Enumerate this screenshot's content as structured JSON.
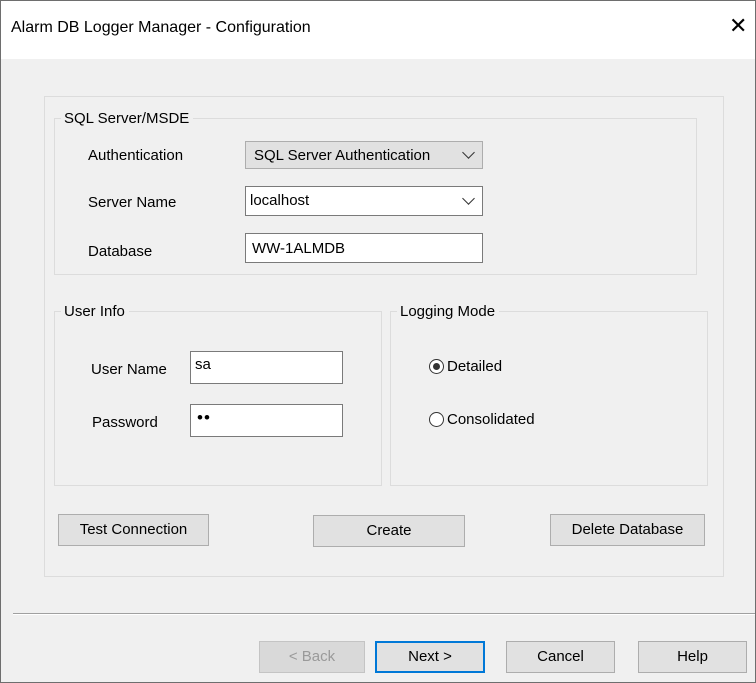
{
  "window": {
    "title": "Alarm DB Logger Manager - Configuration",
    "close_glyph": "✕"
  },
  "sql": {
    "legend": "SQL Server/MSDE",
    "auth_label": "Authentication",
    "auth_value": "SQL Server Authentication",
    "server_label": "Server Name",
    "server_value": "localhost",
    "db_label": "Database",
    "db_value": "WW-1ALMDB"
  },
  "user": {
    "legend": "User Info",
    "name_label": "User Name",
    "name_value": "sa",
    "pass_label": "Password",
    "pass_value": "••"
  },
  "logging": {
    "legend": "Logging Mode",
    "options": [
      {
        "label": "Detailed",
        "selected": true
      },
      {
        "label": "Consolidated",
        "selected": false
      }
    ]
  },
  "actions": {
    "test": "Test Connection",
    "create": "Create",
    "delete": "Delete Database"
  },
  "footer": {
    "back": "< Back",
    "next": "Next >",
    "cancel": "Cancel",
    "help": "Help"
  }
}
